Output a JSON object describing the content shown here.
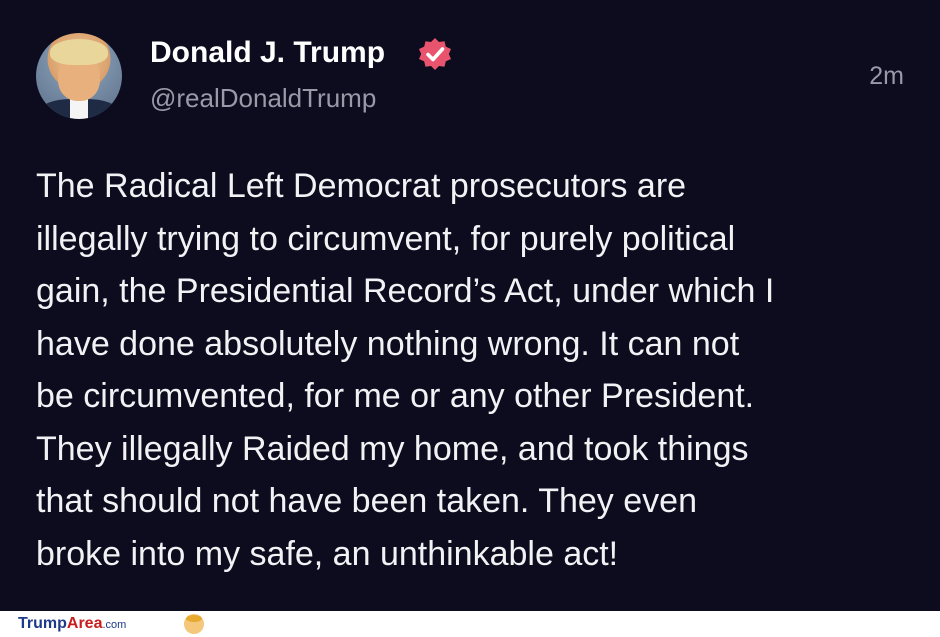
{
  "post": {
    "display_name": "Donald J. Trump",
    "handle": "@realDonaldTrump",
    "timestamp": "2m",
    "body_lines": [
      "The Radical Left Democrat prosecutors are",
      "illegally trying to circumvent, for purely political",
      "gain, the Presidential Record’s Act, under which I",
      "have done absolutely nothing wrong. It can not",
      "be circumvented, for me or any other President.",
      "They illegally Raided my home, and took things",
      "that should not have been taken. They even",
      "broke into my safe, an unthinkable act!"
    ],
    "verified_badge_color": "#e8546e",
    "avatar_icon": "profile-photo"
  },
  "footer": {
    "brand_part1": "Trump",
    "brand_part2": "Area",
    "brand_part3": ".com",
    "brand_icon": "trump-face-logo"
  },
  "colors": {
    "background": "#0d0b1e",
    "text": "#f2f2f5",
    "secondary_text": "#9b98a8"
  }
}
